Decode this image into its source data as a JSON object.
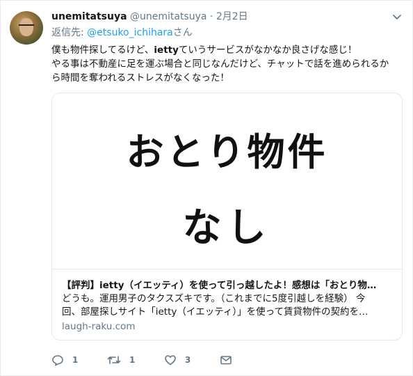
{
  "tweet": {
    "display_name": "unemitatsuya",
    "handle": "@unemitatsuya",
    "separator": "·",
    "date": "2月2日",
    "reply_prefix": "返信先: ",
    "reply_mention": "@etsuko_ichihara",
    "reply_suffix": "さん",
    "text_line1_a": "僕も物件探してるけど、",
    "text_line1_bold": "ietty",
    "text_line1_b": "ていうサービスがなかなか良さげな感じ！",
    "text_line2": "やる事は不動産に足を運ぶ場合と同じなんだけど、チャットで話を進められるか",
    "text_line3": "ら時間を奪われるストレスがなくなった！"
  },
  "card": {
    "image_text_line1": "おとり物件",
    "image_text_line2": "なし",
    "title": "【評判】ietty（イエッティ）を使って引っ越したよ！感想は「おとり物…",
    "desc_line1": "どうも。運用男子のタクスズキです。（これまでに5度引越しを経験） 今",
    "desc_line2": "回、部屋探しサイト「ietty（イエッティ）」を使って賃貸物件の契約を…",
    "domain": "laugh-raku.com"
  },
  "actions": {
    "reply_count": "1",
    "retweet_count": "1",
    "like_count": "3"
  },
  "icons": {
    "caret": "chevron-down-icon",
    "reply": "reply-icon",
    "retweet": "retweet-icon",
    "like": "heart-icon",
    "dm": "envelope-icon"
  },
  "colors": {
    "link": "#1da1f2",
    "secondary": "#657786",
    "text": "#14171a",
    "border": "#e1e8ed"
  }
}
